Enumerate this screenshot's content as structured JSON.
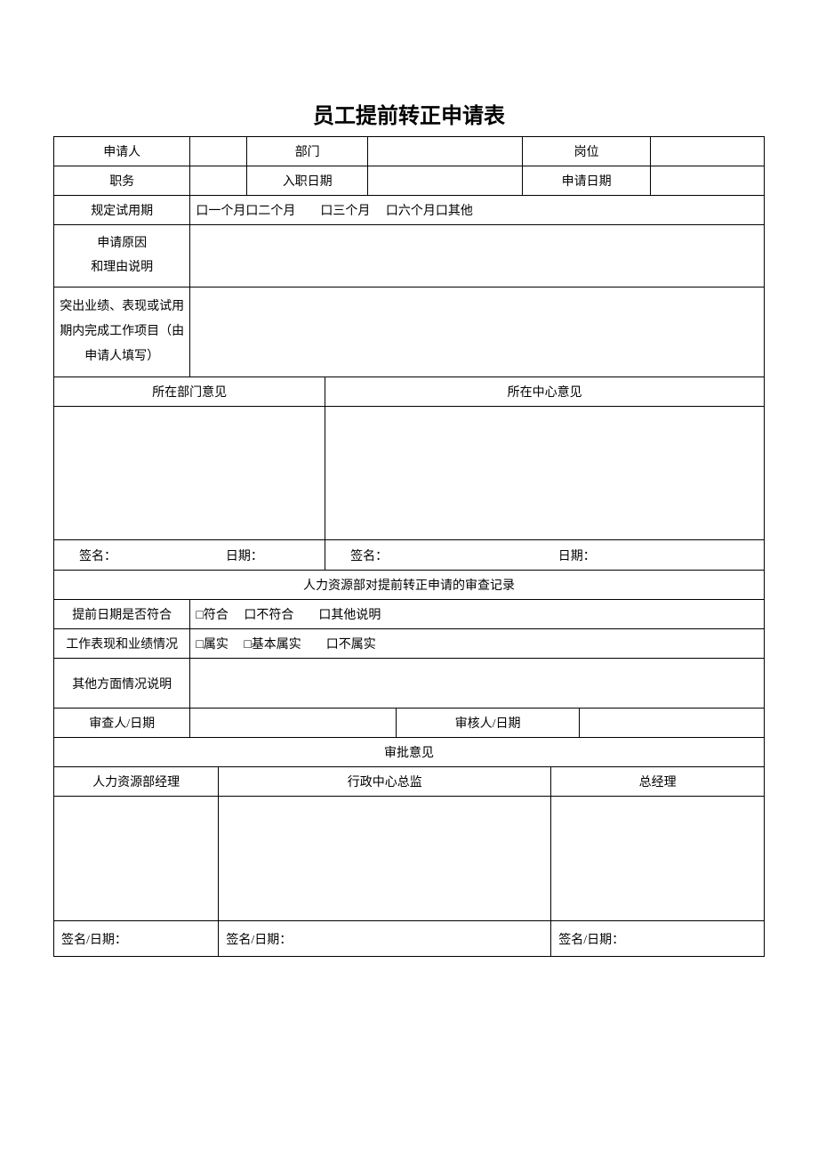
{
  "title": "员工提前转正申请表",
  "row1": {
    "applicant": "申请人",
    "dept": "部门",
    "post": "岗位"
  },
  "row2": {
    "job": "职务",
    "entryDate": "入职日期",
    "applyDate": "申请日期"
  },
  "row3": {
    "label": "规定试用期",
    "options": "口一个月口二个月  口三个月  口六个月口其他"
  },
  "row4": {
    "label": "申请原因\n和理由说明"
  },
  "row5": {
    "label": "突出业绩、表现或试用期内完成工作项目（由申请人填写）"
  },
  "opinions": {
    "dept": "所在部门意见",
    "center": "所在中心意见"
  },
  "sig": {
    "sign": "签名：",
    "date": "日期："
  },
  "hrHeader": "人力资源部对提前转正申请的审查记录",
  "checkRow1": {
    "label": "提前日期是否符合",
    "opts": "□符合  口不符合  口其他说明"
  },
  "checkRow2": {
    "label": "工作表现和业绩情况",
    "opts": "□属实  □基本属实  口不属实"
  },
  "checkRow3": {
    "label": "其他方面情况说明"
  },
  "reviewer": "审查人/日期",
  "auditor": "审核人/日期",
  "approvalHeader": "审批意见",
  "approvers": {
    "hr": "人力资源部经理",
    "admin": "行政中心总监",
    "gm": "总经理"
  },
  "sigDate": "签名/日期："
}
